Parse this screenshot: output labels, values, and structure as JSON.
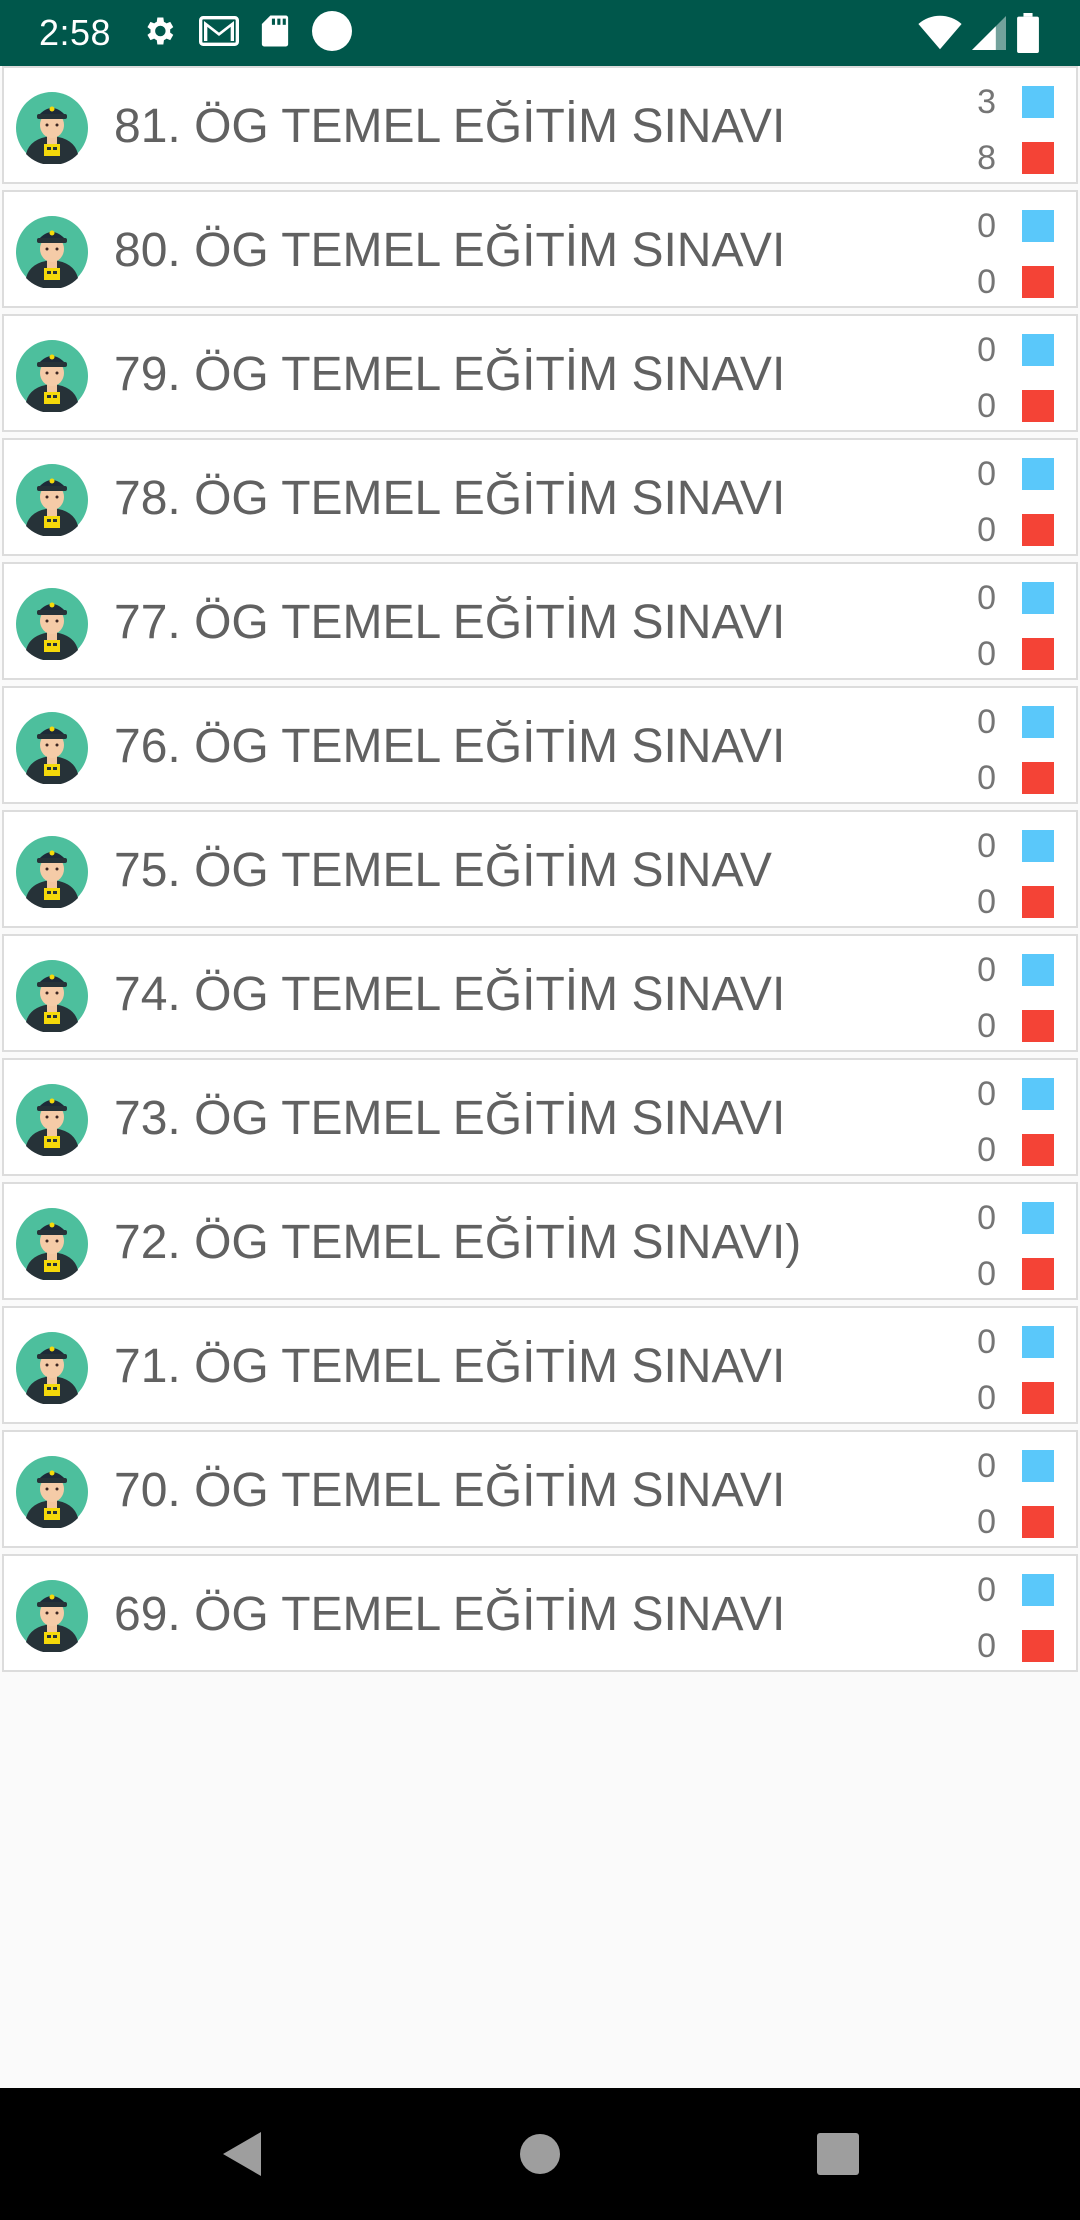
{
  "status_bar": {
    "time": "2:58",
    "icons_left": [
      "gear-icon",
      "gmail-icon",
      "sd-card-icon",
      "circle-icon"
    ],
    "icons_right": [
      "wifi-icon",
      "cell-signal-icon",
      "battery-icon"
    ]
  },
  "colors": {
    "status_bar": "#00574b",
    "blue_swatch": "#5ac8fa",
    "red_swatch": "#f44336",
    "title_text": "#616161"
  },
  "exams": [
    {
      "title": "81. ÖG TEMEL EĞİTİM SINAVI",
      "blue_count": "3",
      "red_count": "8"
    },
    {
      "title": "80. ÖG TEMEL EĞİTİM SINAVI",
      "blue_count": "0",
      "red_count": "0"
    },
    {
      "title": "79. ÖG TEMEL EĞİTİM SINAVI",
      "blue_count": "0",
      "red_count": "0"
    },
    {
      "title": "78. ÖG TEMEL EĞİTİM SINAVI",
      "blue_count": "0",
      "red_count": "0"
    },
    {
      "title": "77. ÖG TEMEL EĞİTİM SINAVI",
      "blue_count": "0",
      "red_count": "0"
    },
    {
      "title": "76. ÖG TEMEL EĞİTİM SINAVI",
      "blue_count": "0",
      "red_count": "0"
    },
    {
      "title": "75. ÖG TEMEL EĞİTİM SINAV",
      "blue_count": "0",
      "red_count": "0"
    },
    {
      "title": "74. ÖG TEMEL EĞİTİM SINAVI",
      "blue_count": "0",
      "red_count": "0"
    },
    {
      "title": "73. ÖG TEMEL EĞİTİM SINAVI",
      "blue_count": "0",
      "red_count": "0"
    },
    {
      "title": "72. ÖG TEMEL EĞİTİM SINAVI)",
      "blue_count": "0",
      "red_count": "0"
    },
    {
      "title": "71. ÖG TEMEL EĞİTİM SINAVI",
      "blue_count": "0",
      "red_count": "0"
    },
    {
      "title": "70. ÖG TEMEL EĞİTİM SINAVI",
      "blue_count": "0",
      "red_count": "0"
    },
    {
      "title": "69. ÖG TEMEL EĞİTİM SINAVI",
      "blue_count": "0",
      "red_count": "0"
    }
  ],
  "nav_bar": {
    "buttons": [
      "back-icon",
      "home-icon",
      "recents-icon"
    ]
  }
}
